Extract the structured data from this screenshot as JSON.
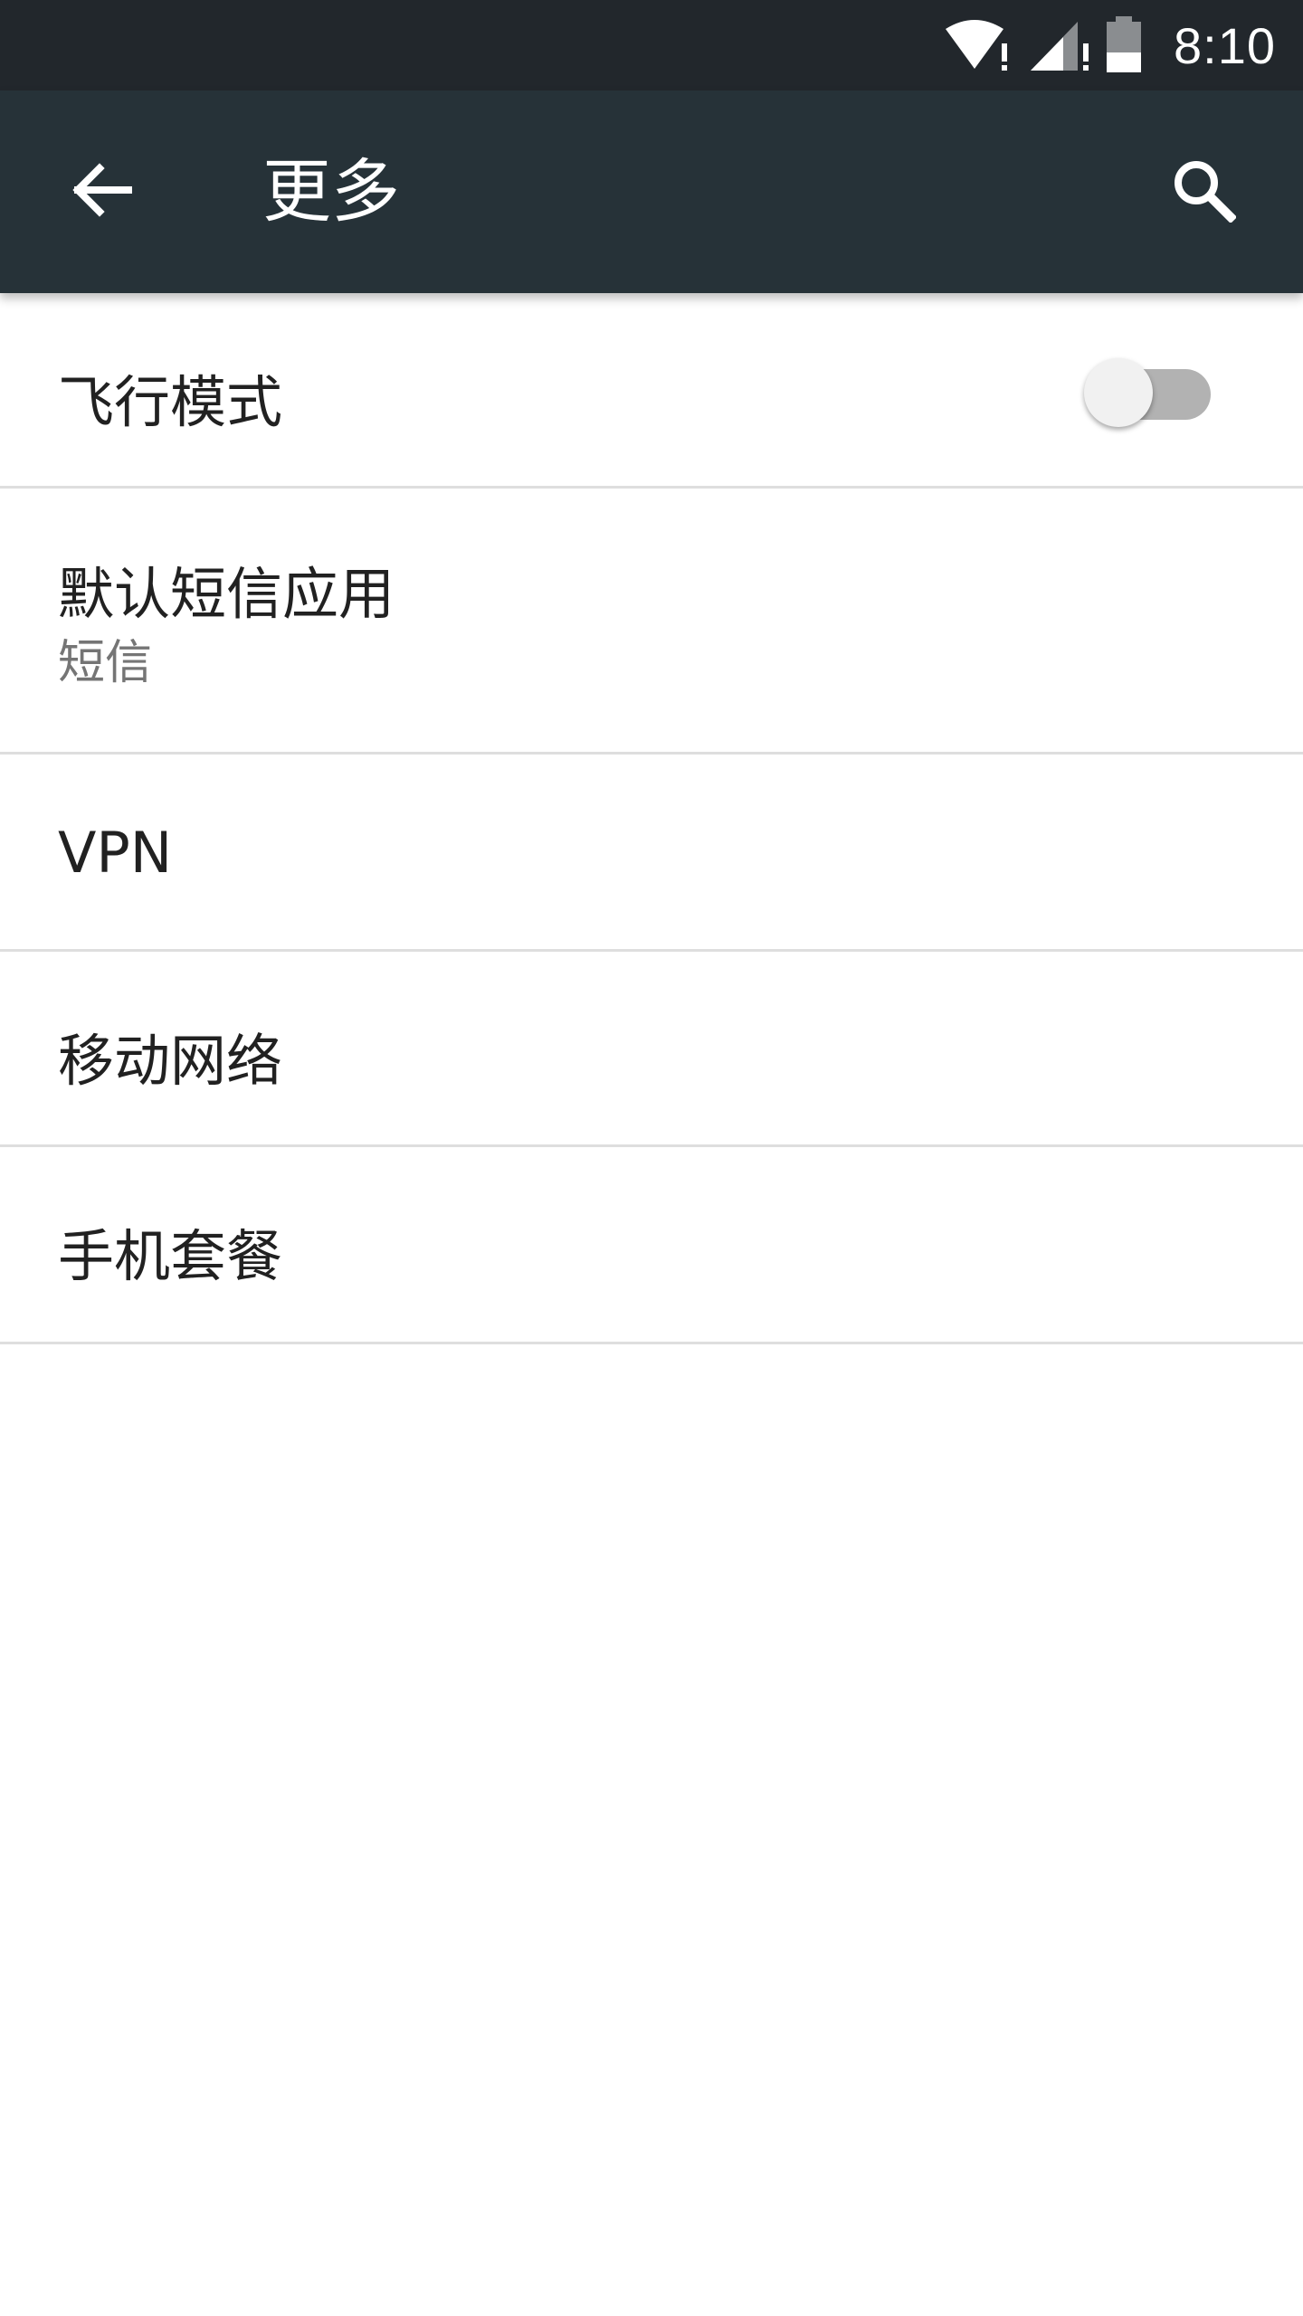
{
  "status_bar": {
    "time": "8:10",
    "icons": [
      "wifi-alert-icon",
      "signal-alert-icon",
      "battery-icon"
    ]
  },
  "app_bar": {
    "title": "更多",
    "back_icon": "arrow-back-icon",
    "search_icon": "search-icon",
    "background": "#263238"
  },
  "settings": {
    "airplane_mode": {
      "label": "飞行模式",
      "enabled": false
    },
    "default_sms": {
      "label": "默认短信应用",
      "summary": "短信"
    },
    "vpn": {
      "label": "VPN"
    },
    "mobile_network": {
      "label": "移动网络"
    },
    "phone_plan": {
      "label": "手机套餐"
    }
  }
}
